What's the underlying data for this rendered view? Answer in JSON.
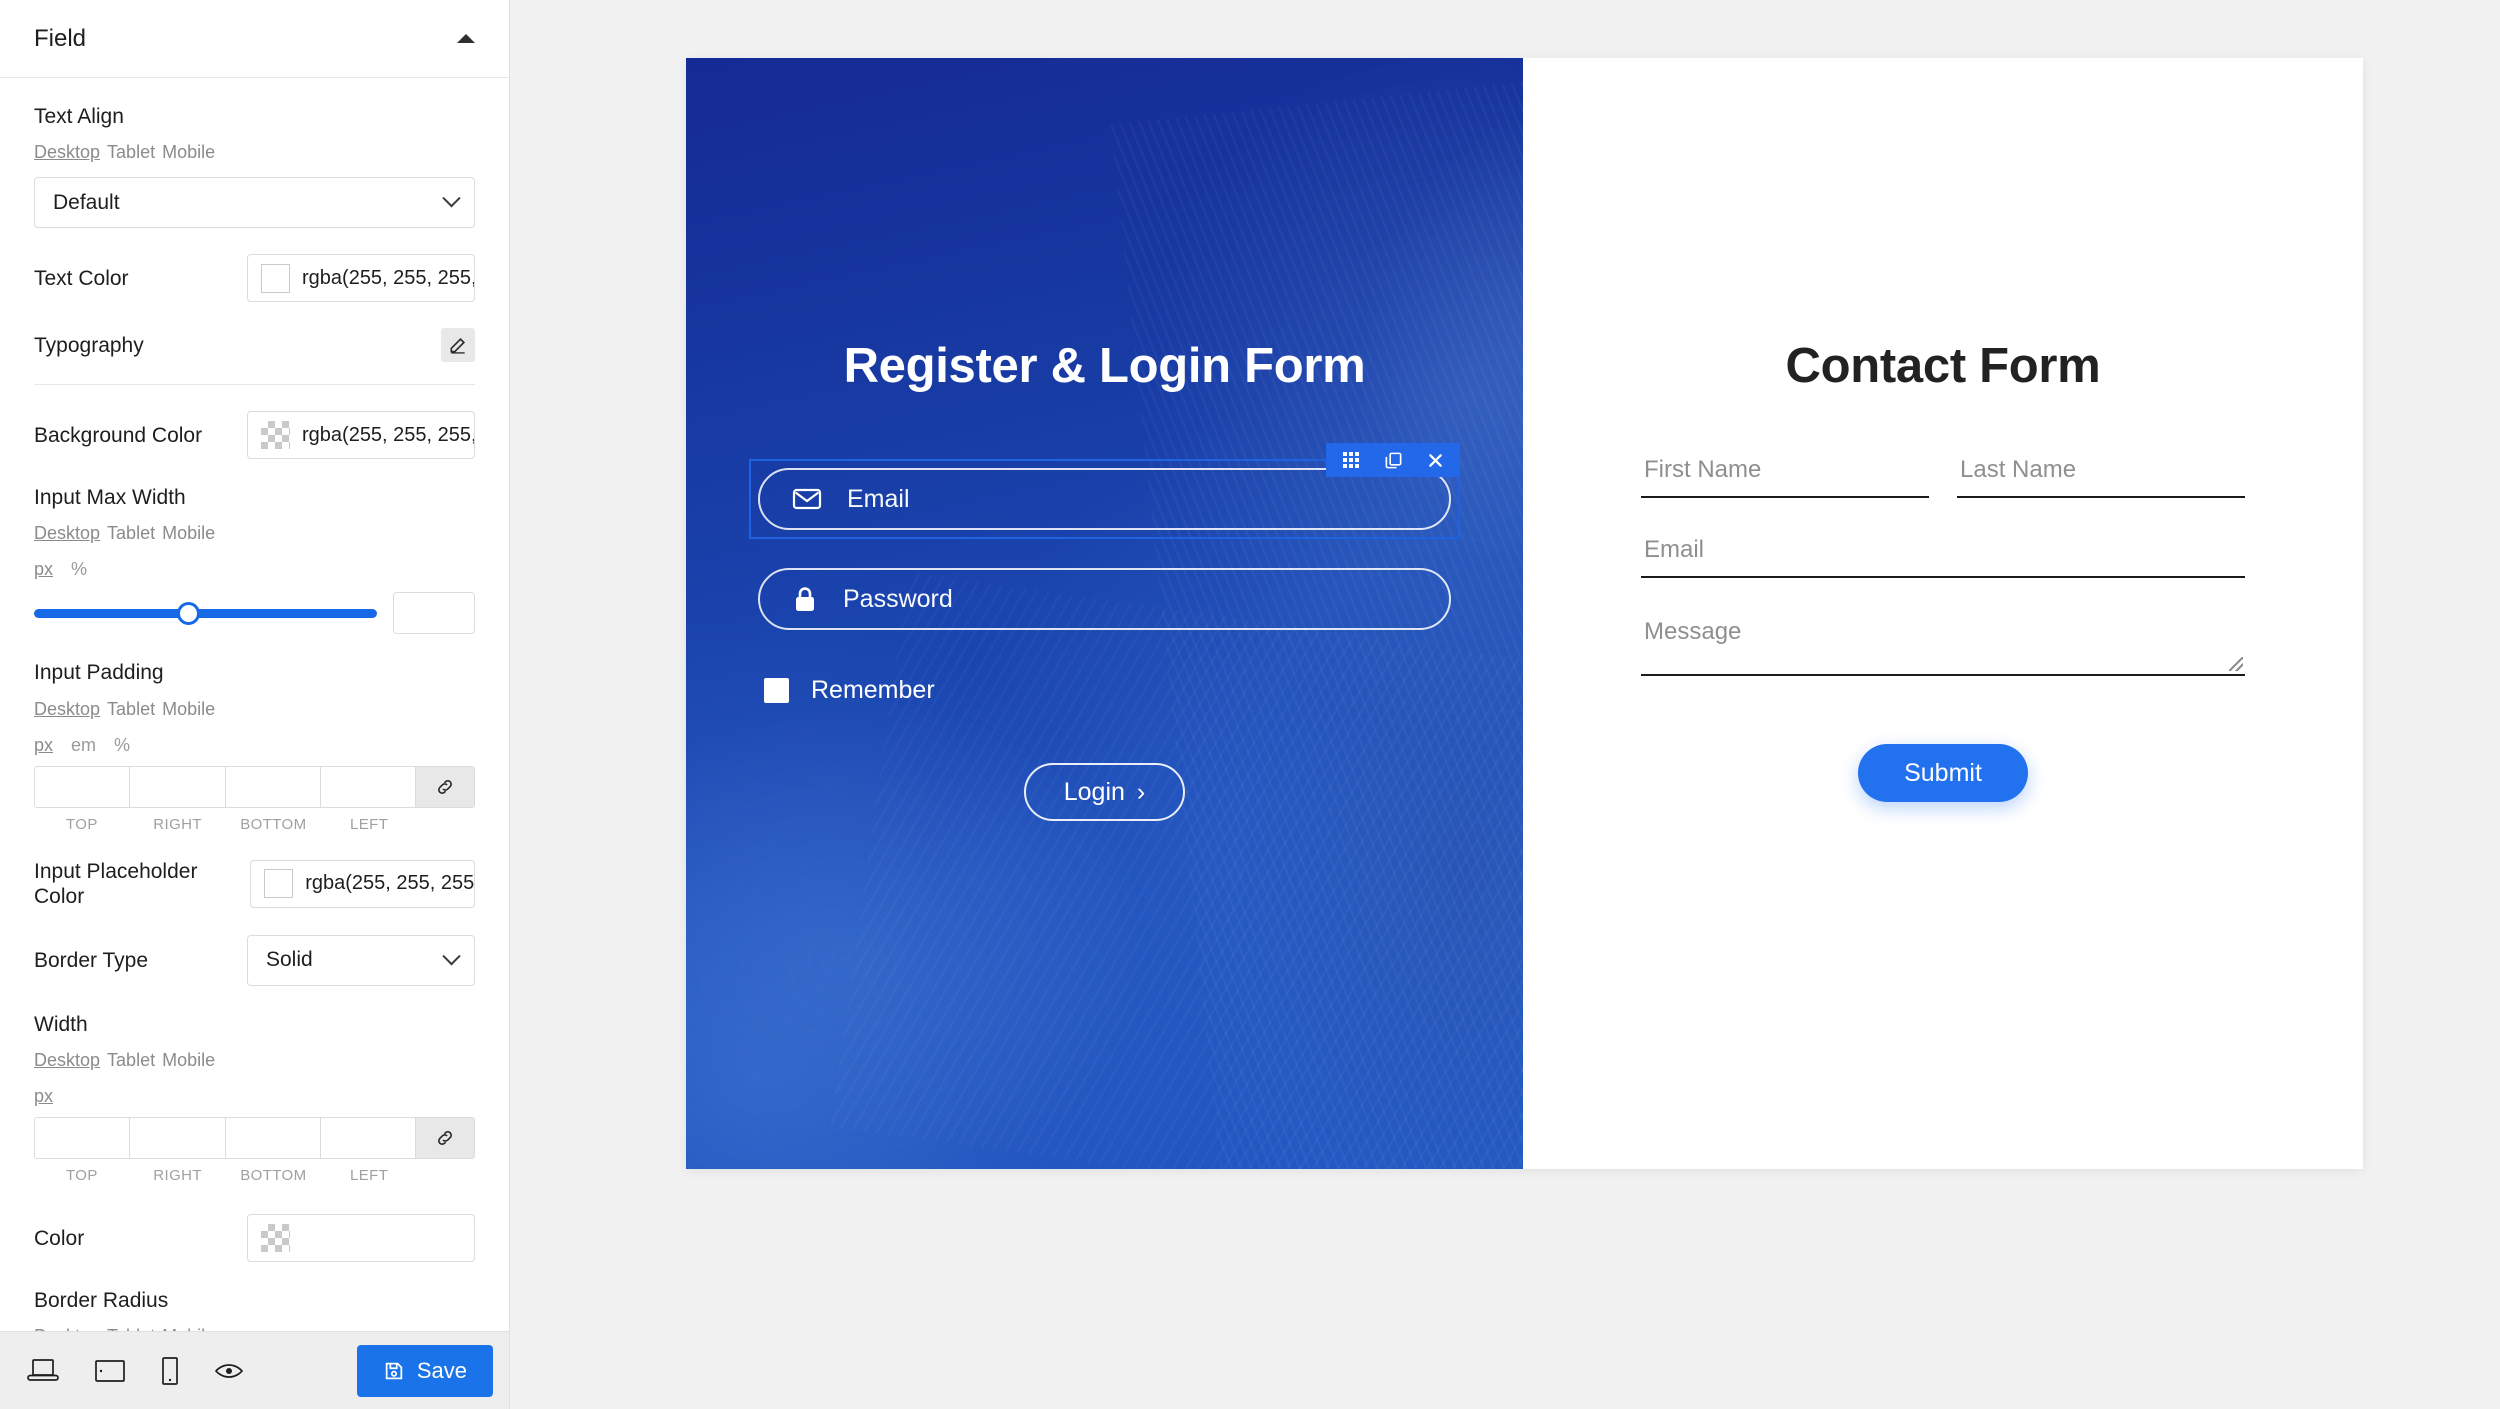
{
  "sidebar": {
    "panel": {
      "title": "Field",
      "collapse_icon": "caret-up-icon"
    },
    "responsive": {
      "desktop": "Desktop",
      "tablet": "Tablet",
      "mobile": "Mobile"
    },
    "controls": {
      "text_align": {
        "label": "Text Align",
        "value": "Default"
      },
      "text_color": {
        "label": "Text Color",
        "value": "rgba(255, 255, 255,"
      },
      "typography": {
        "label": "Typography",
        "edit_icon": "pencil-icon"
      },
      "background_color": {
        "label": "Background Color",
        "value": "rgba(255, 255, 255,"
      },
      "input_max_width": {
        "label": "Input Max Width",
        "units": [
          "px",
          "%"
        ],
        "active_unit": "px",
        "slider_percent": 45,
        "number_value": ""
      },
      "input_padding": {
        "label": "Input Padding",
        "units": [
          "px",
          "em",
          "%"
        ],
        "active_unit": "px",
        "sides": [
          "TOP",
          "RIGHT",
          "BOTTOM",
          "LEFT"
        ],
        "values": [
          "",
          "",
          "",
          ""
        ],
        "link_icon": "link-icon"
      },
      "input_placeholder_color": {
        "label": "Input Placeholder Color",
        "value": "rgba(255, 255, 255,"
      },
      "border_type": {
        "label": "Border Type",
        "value": "Solid"
      },
      "width": {
        "label": "Width",
        "units": [
          "px"
        ],
        "active_unit": "px",
        "sides": [
          "TOP",
          "RIGHT",
          "BOTTOM",
          "LEFT"
        ],
        "values": [
          "",
          "",
          "",
          ""
        ],
        "link_icon": "link-icon"
      },
      "color": {
        "label": "Color",
        "value": ""
      },
      "border_radius": {
        "label": "Border Radius"
      }
    },
    "bottom_bar": {
      "devices": [
        {
          "name": "desktop-view-icon",
          "label": "Desktop"
        },
        {
          "name": "tablet-view-icon",
          "label": "Tablet"
        },
        {
          "name": "mobile-view-icon",
          "label": "Mobile"
        },
        {
          "name": "preview-eye-icon",
          "label": "Preview"
        }
      ],
      "save_label": "Save",
      "save_icon": "floppy-disk-icon",
      "save_color": "#1a73e8"
    }
  },
  "canvas": {
    "login": {
      "title": "Register & Login Form",
      "email": {
        "placeholder": "Email",
        "icon": "envelope-icon"
      },
      "password": {
        "placeholder": "Password",
        "icon": "lock-icon"
      },
      "remember": {
        "label": "Remember"
      },
      "login_button": {
        "label": "Login",
        "arrow": "›"
      },
      "element_toolbar": [
        {
          "name": "grid-handle-icon",
          "label": ""
        },
        {
          "name": "duplicate-icon",
          "label": ""
        },
        {
          "name": "close-icon",
          "label": "✕"
        }
      ],
      "accent": "#2268e8"
    },
    "contact": {
      "title": "Contact Form",
      "first_name": "First Name",
      "last_name": "Last Name",
      "email": "Email",
      "message": "Message",
      "submit_label": "Submit",
      "submit_color": "#2272f0"
    }
  }
}
